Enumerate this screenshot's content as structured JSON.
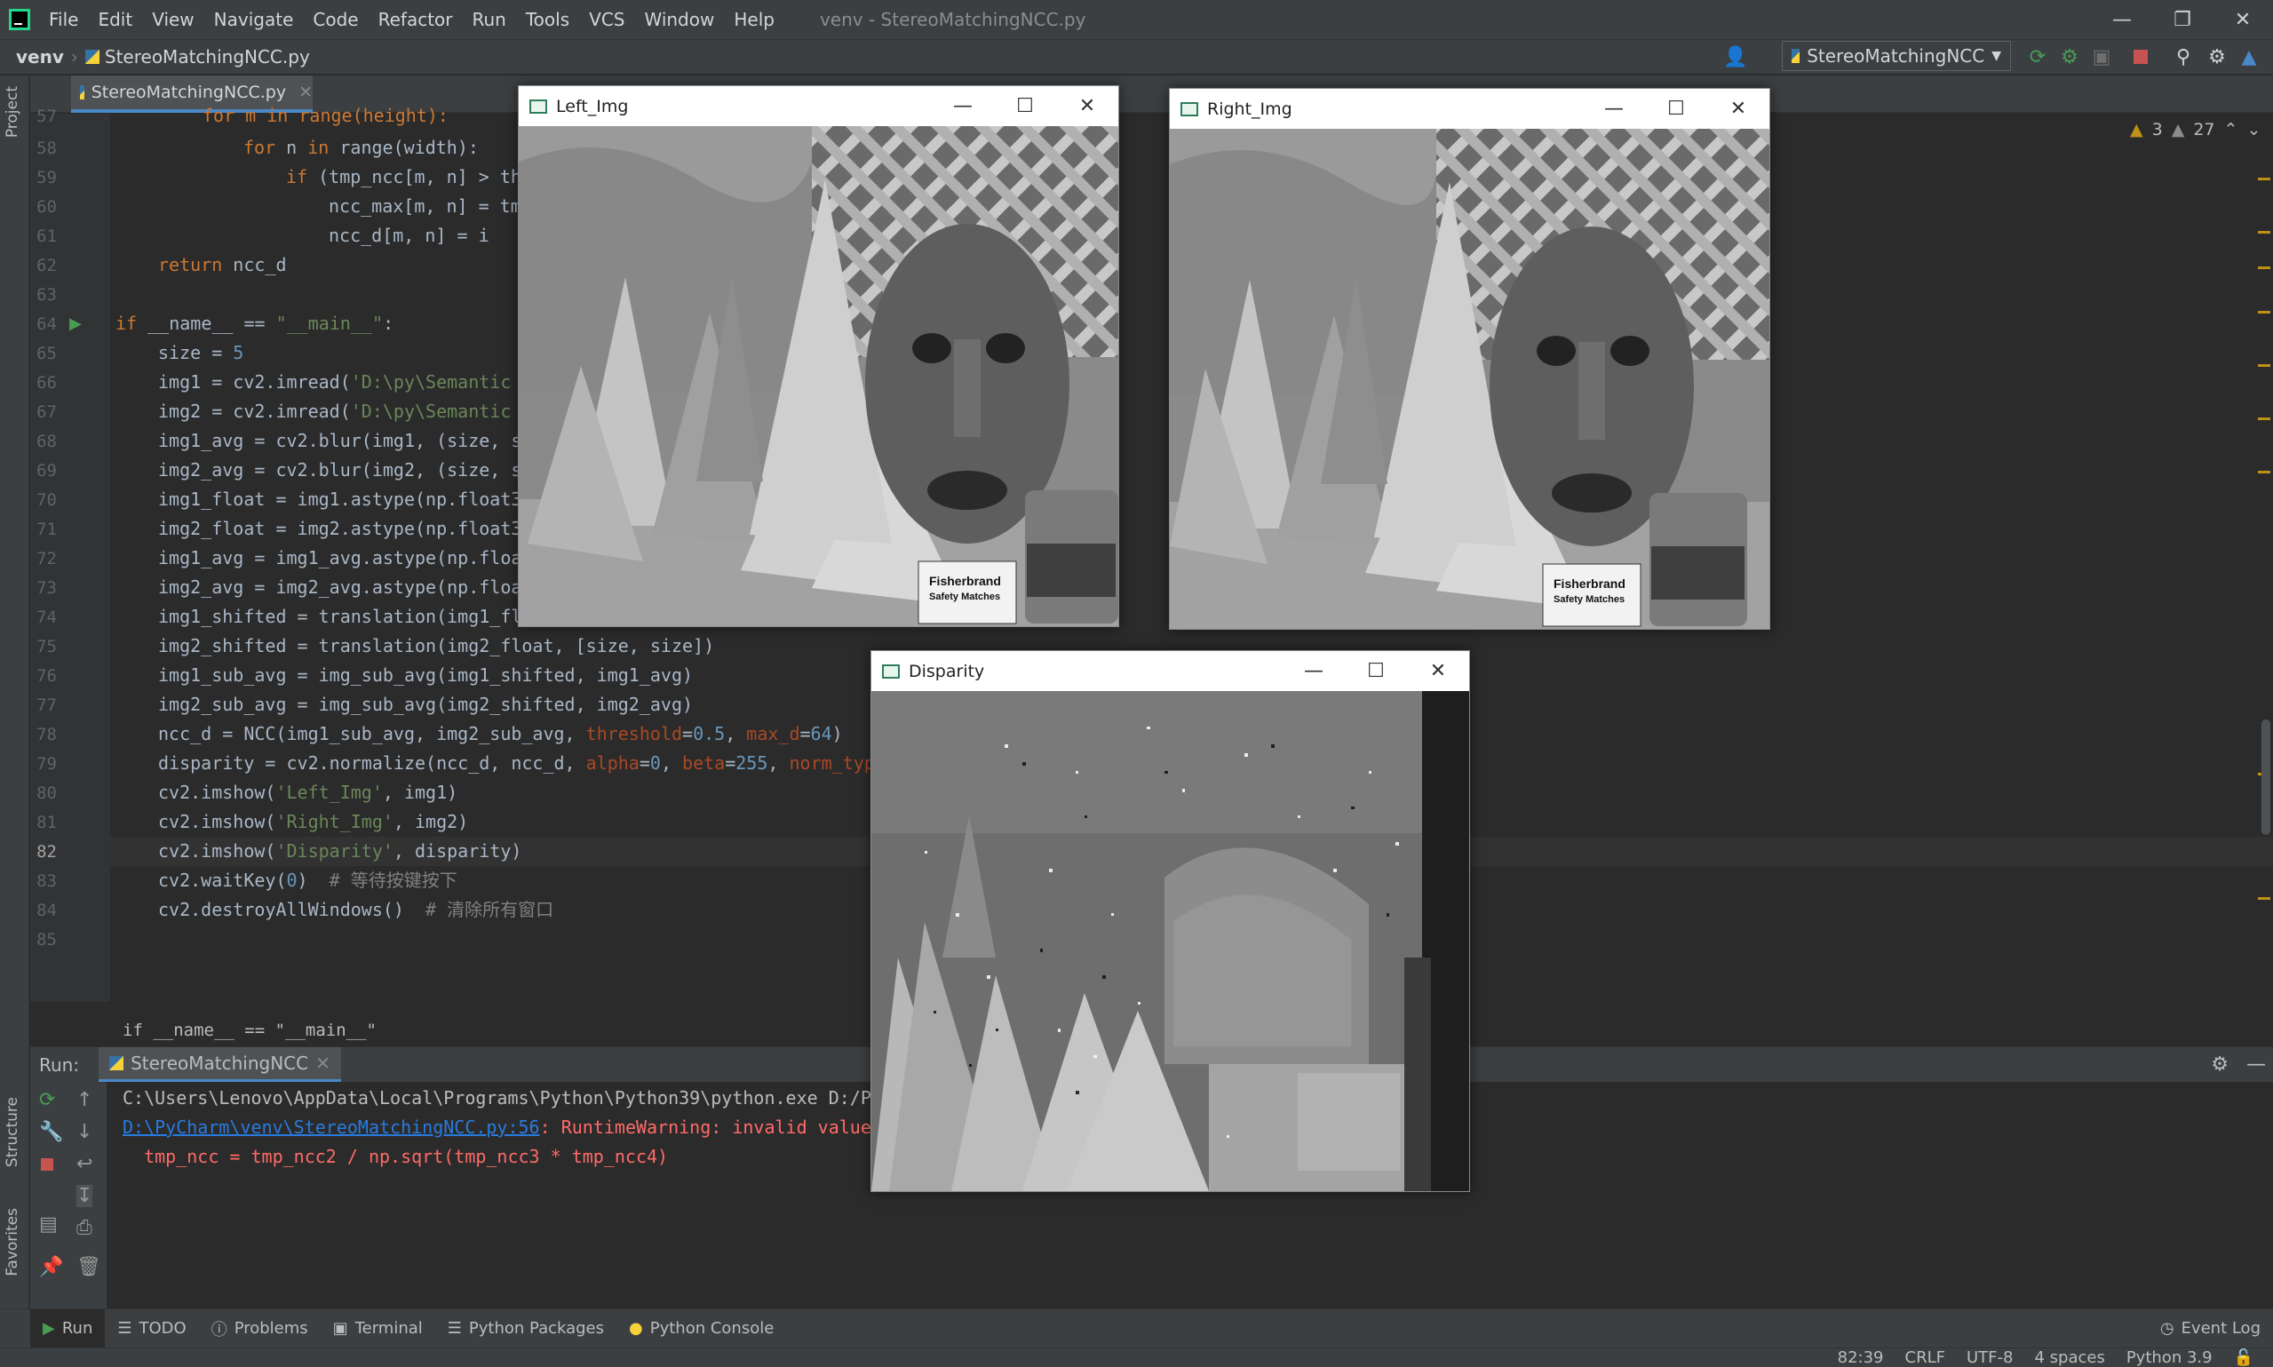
{
  "menubar": {
    "items": [
      "File",
      "Edit",
      "View",
      "Navigate",
      "Code",
      "Refactor",
      "Run",
      "Tools",
      "VCS",
      "Window",
      "Help"
    ],
    "window_title": "venv - StereoMatchingNCC.py"
  },
  "navbar": {
    "project": "venv",
    "file": "StereoMatchingNCC.py",
    "run_config": "StereoMatchingNCC"
  },
  "left_tool": {
    "project": "Project",
    "structure": "Structure",
    "favorites": "Favorites"
  },
  "editor": {
    "tab": "StereoMatchingNCC.py",
    "inspections": {
      "errors": "3",
      "warnings": "27"
    },
    "line_numbers": [
      "57",
      "58",
      "59",
      "60",
      "61",
      "62",
      "63",
      "64",
      "65",
      "66",
      "67",
      "68",
      "69",
      "70",
      "71",
      "72",
      "73",
      "74",
      "75",
      "76",
      "77",
      "78",
      "79",
      "80",
      "81",
      "82",
      "83",
      "84",
      "85"
    ],
    "breadcrumb": "if __name__ == \"__main__\"",
    "code": {
      "l57": "for m in range(height):",
      "l58a": "for",
      "l58b": " n ",
      "l58c": "in",
      "l58d": " range(width):",
      "l59a": "if",
      "l59b": " (tmp_ncc[m, n] > th",
      "l60": "ncc_max[m, n] = tm",
      "l61": "ncc_d[m, n] = i",
      "l62a": "return",
      "l62b": " ncc_d",
      "l64a": "if",
      "l64b": " __name__ == ",
      "l64c": "\"__main__\"",
      "l64d": ":",
      "l65a": "size = ",
      "l65b": "5",
      "l66a": "img1 = cv2.imread(",
      "l66b": "'D:\\py\\Semantic",
      "l67a": "img2 = cv2.imread(",
      "l67b": "'D:\\py\\Semantic",
      "l68": "img1_avg = cv2.blur(img1, (size, s",
      "l69": "img2_avg = cv2.blur(img2, (size, s",
      "l70": "img1_float = img1.astype(np.float3",
      "l71": "img2_float = img2.astype(np.float3",
      "l72": "img1_avg = img1_avg.astype(np.floa",
      "l73": "img2_avg = img2_avg.astype(np.floa",
      "l74": "img1_shifted = translation(img1_fl",
      "l75": "img2_shifted = translation(img2_float, [size, size])",
      "l76": "img1_sub_avg = img_sub_avg(img1_shifted, img1_avg)",
      "l77": "img2_sub_avg = img_sub_avg(img2_shifted, img2_avg)",
      "l78a": "ncc_d = NCC(img1_sub_avg, img2_sub_avg, ",
      "l78b": "threshold",
      "l78c": "=",
      "l78d": "0.5",
      "l78e": ", ",
      "l78f": "max_d",
      "l78g": "=",
      "l78h": "64",
      "l78i": ")",
      "l79a": "disparity = cv2.normalize(ncc_d, ncc_d, ",
      "l79b": "alpha",
      "l79c": "=",
      "l79d": "0",
      "l79e": ", ",
      "l79f": "beta",
      "l79g": "=",
      "l79h": "255",
      "l79i": ", ",
      "l79j": "norm_typ",
      "l80a": "cv2.imshow(",
      "l80b": "'Left_Img'",
      "l80c": ", img1)",
      "l81a": "cv2.imshow(",
      "l81b": "'Right_Img'",
      "l81c": ", img2)",
      "l82a": "cv2.imshow(",
      "l82b": "'Disparity'",
      "l82c": ", disparity)",
      "l83a": "cv2.waitKey(",
      "l83b": "0",
      "l83c": ")  ",
      "l83d": "# 等待按键按下",
      "l84a": "cv2.destroyAllWindows()  ",
      "l84b": "# 清除所有窗口"
    }
  },
  "run_panel": {
    "label": "Run:",
    "tab": "StereoMatchingNCC",
    "console": {
      "line1": "C:\\Users\\Lenovo\\AppData\\Local\\Programs\\Python\\Python39\\python.exe D:/P",
      "line2_link": "D:\\PyCharm\\venv\\StereoMatchingNCC.py:56",
      "line2_rest": ": RuntimeWarning: invalid value",
      "line3": "  tmp_ncc = tmp_ncc2 / np.sqrt(tmp_ncc3 * tmp_ncc4)"
    }
  },
  "bottom_tabs": [
    "Run",
    "TODO",
    "Problems",
    "Terminal",
    "Python Packages",
    "Python Console"
  ],
  "event_log": "Event Log",
  "status": {
    "position": "82:39",
    "line_sep": "CRLF",
    "encoding": "UTF-8",
    "indent": "4 spaces",
    "interpreter": "Python 3.9"
  },
  "cv_windows": {
    "left": "Left_Img",
    "right": "Right_Img",
    "disparity": "Disparity"
  },
  "colors": {
    "accent": "#4a88c7",
    "run_green": "#499c54",
    "stop_red": "#c75450",
    "warning": "#be9117"
  }
}
